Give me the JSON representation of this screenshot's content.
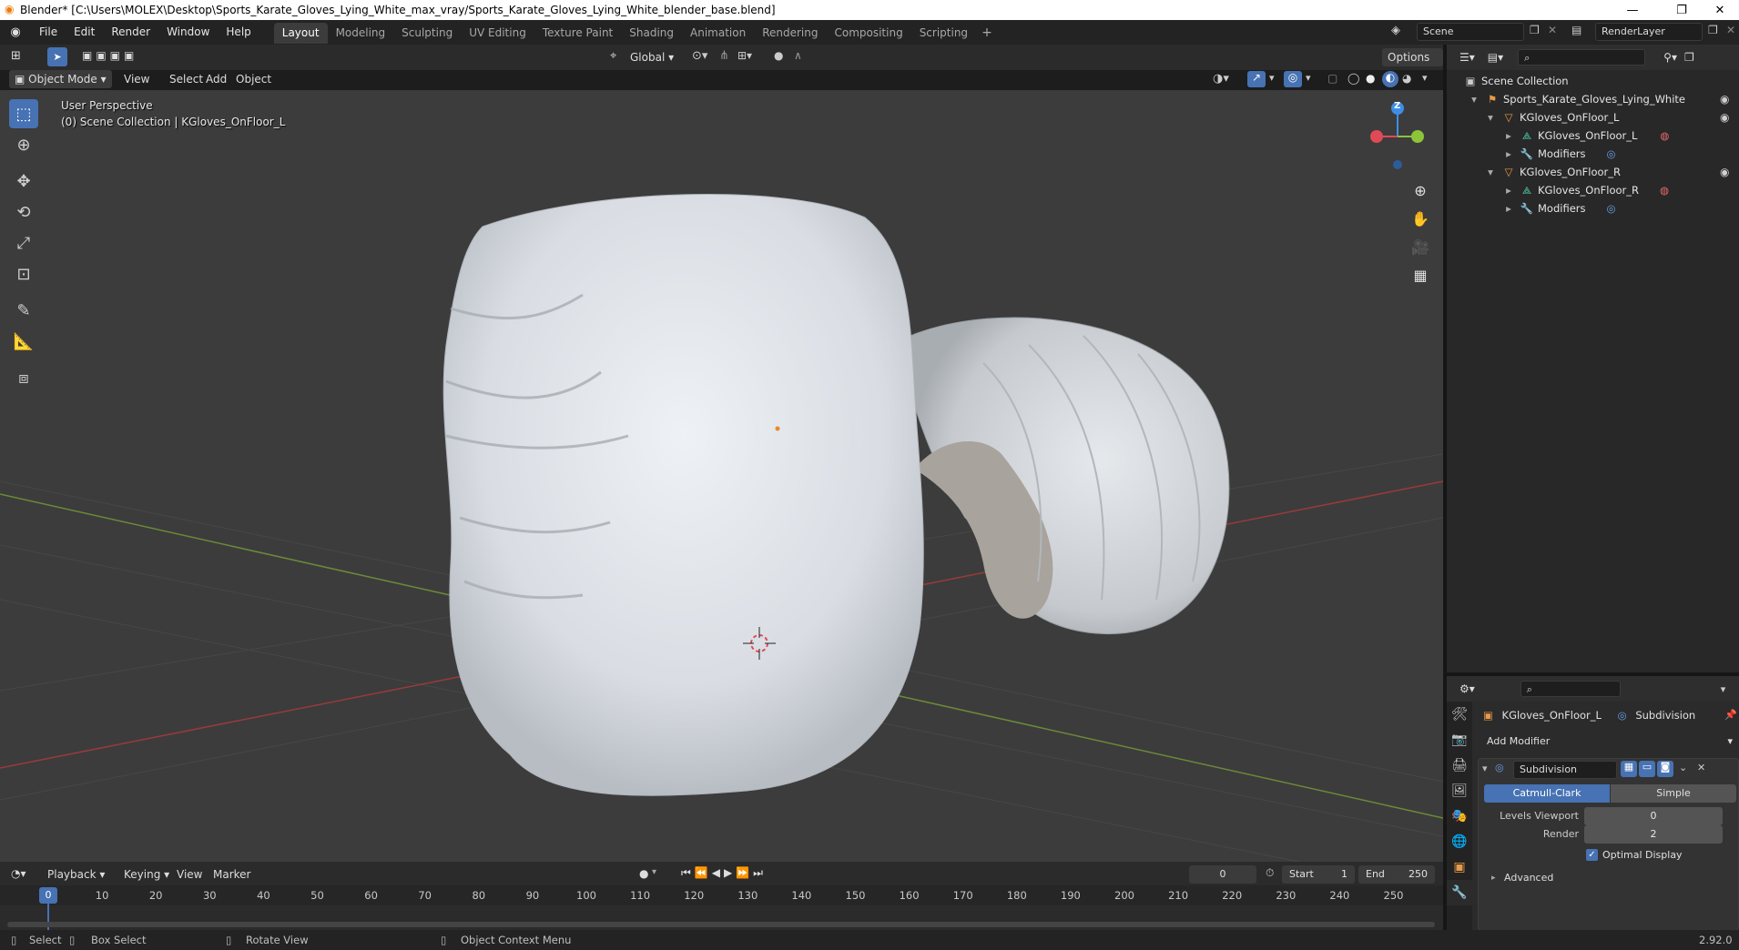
{
  "window": {
    "title": "Blender* [C:\\Users\\MOLEX\\Desktop\\Sports_Karate_Gloves_Lying_White_max_vray/Sports_Karate_Gloves_Lying_White_blender_base.blend]",
    "minimize": "—",
    "maximize": "❐",
    "close": "✕"
  },
  "menus": [
    "File",
    "Edit",
    "Render",
    "Window",
    "Help"
  ],
  "workspaces": [
    "Layout",
    "Modeling",
    "Sculpting",
    "UV Editing",
    "Texture Paint",
    "Shading",
    "Animation",
    "Rendering",
    "Compositing",
    "Scripting"
  ],
  "active_workspace": "Layout",
  "scene_field": "Scene",
  "renderlayer_field": "RenderLayer",
  "viewport_header": {
    "mode": "Object Mode",
    "menus": [
      "View",
      "Select",
      "Add",
      "Object"
    ],
    "orientation": "Global",
    "options": "Options"
  },
  "viewport": {
    "perspective": "User Perspective",
    "collection_info": "(0) Scene Collection | KGloves_OnFloor_L",
    "gizmo_z": "Z"
  },
  "outliner": {
    "root": "Scene Collection",
    "rows": [
      {
        "label": "Sports_Karate_Gloves_Lying_White"
      },
      {
        "label": "KGloves_OnFloor_L"
      },
      {
        "label": "KGloves_OnFloor_L"
      },
      {
        "label": "Modifiers"
      },
      {
        "label": "KGloves_OnFloor_R"
      },
      {
        "label": "KGloves_OnFloor_R"
      },
      {
        "label": "Modifiers"
      }
    ]
  },
  "properties": {
    "object_name": "KGloves_OnFloor_L",
    "modifier_crumb": "Subdivision",
    "add_modifier": "Add Modifier",
    "modifier_name": "Subdivision",
    "catmull": "Catmull-Clark",
    "simple": "Simple",
    "levels_viewport_label": "Levels Viewport",
    "levels_viewport_value": "0",
    "render_label": "Render",
    "render_value": "2",
    "optimal_display": "Optimal Display",
    "advanced": "Advanced"
  },
  "timeline": {
    "menus": [
      "Playback",
      "Keying",
      "View",
      "Marker"
    ],
    "current_frame": "0",
    "start_label": "Start",
    "start_value": "1",
    "end_label": "End",
    "end_value": "250",
    "ticks": [
      "0",
      "10",
      "20",
      "30",
      "40",
      "50",
      "60",
      "70",
      "80",
      "90",
      "100",
      "110",
      "120",
      "130",
      "140",
      "150",
      "160",
      "170",
      "180",
      "190",
      "200",
      "210",
      "220",
      "230",
      "240",
      "250"
    ],
    "playhead": "0"
  },
  "statusbar": {
    "select": "Select",
    "box_select": "Box Select",
    "rotate_view": "Rotate View",
    "context_menu": "Object Context Menu",
    "version": "2.92.0"
  },
  "colors": {
    "accent": "#4772b3",
    "x_axis": "#e04a57",
    "y_axis": "#8cc43a",
    "z_axis": "#3e8ee8"
  }
}
